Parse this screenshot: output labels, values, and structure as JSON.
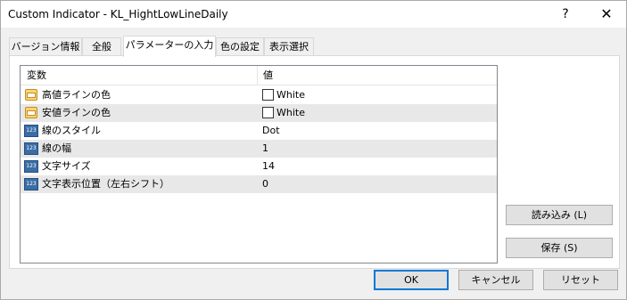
{
  "window": {
    "title": "Custom Indicator - KL_HightLowLineDaily",
    "help_glyph": "?",
    "close_glyph": "✕"
  },
  "tabs": [
    {
      "label": "バージョン情報"
    },
    {
      "label": "全般"
    },
    {
      "label": "パラメーターの入力"
    },
    {
      "label": "色の設定"
    },
    {
      "label": "表示選択"
    }
  ],
  "active_tab": 2,
  "params": {
    "columns": {
      "variable": "変数",
      "value": "値"
    },
    "rows": [
      {
        "name": "高値ラインの色",
        "value": "White",
        "type": "color",
        "icon": "color-param-icon"
      },
      {
        "name": "安値ラインの色",
        "value": "White",
        "type": "color",
        "icon": "color-param-icon"
      },
      {
        "name": "線のスタイル",
        "value": "Dot",
        "type": "number",
        "icon": "numeric-param-icon"
      },
      {
        "name": "線の幅",
        "value": "1",
        "type": "number",
        "icon": "numeric-param-icon"
      },
      {
        "name": "文字サイズ",
        "value": "14",
        "type": "number",
        "icon": "numeric-param-icon"
      },
      {
        "name": "文字表示位置（左右シフト）",
        "value": "0",
        "type": "number",
        "icon": "numeric-param-icon"
      }
    ],
    "num_icon_text": "123"
  },
  "buttons": {
    "load": "読み込み (L)",
    "save": "保存 (S)",
    "ok": "OK",
    "cancel": "キャンセル",
    "reset": "リセット"
  },
  "colors": {
    "selected_tab": "#ffffff",
    "default_button_border": "#0078d7",
    "alt_row": "#e8e8e8"
  }
}
